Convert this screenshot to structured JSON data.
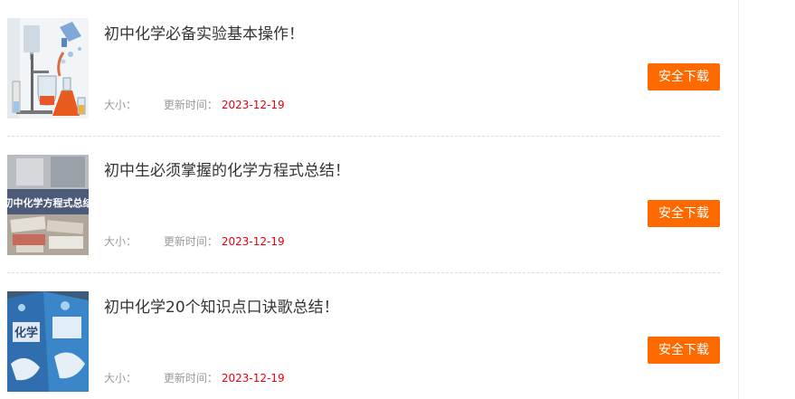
{
  "items": [
    {
      "title": "初中化学必备实验基本操作！",
      "size_label": "大小：",
      "size_value": "",
      "updated_label": "更新时间：",
      "updated_date": "2023-12-19",
      "download_label": "安全下载",
      "thumb_icon": "chemistry-lab-equipment-image"
    },
    {
      "title": "初中生必须掌握的化学方程式总结！",
      "size_label": "大小：",
      "size_value": "",
      "updated_label": "更新时间：",
      "updated_date": "2023-12-19",
      "download_label": "安全下载",
      "thumb_icon": "chemistry-books-image",
      "thumb_text": "初中化学方程式总结"
    },
    {
      "title": "初中化学20个知识点口诀歌总结！",
      "size_label": "大小：",
      "size_value": "",
      "updated_label": "更新时间：",
      "updated_date": "2023-12-19",
      "download_label": "安全下载",
      "thumb_icon": "chemistry-textbooks-image",
      "thumb_text": "化学"
    }
  ],
  "colors": {
    "button": "#ff6a00",
    "date": "#e60012",
    "meta": "#999999",
    "title": "#333333"
  }
}
